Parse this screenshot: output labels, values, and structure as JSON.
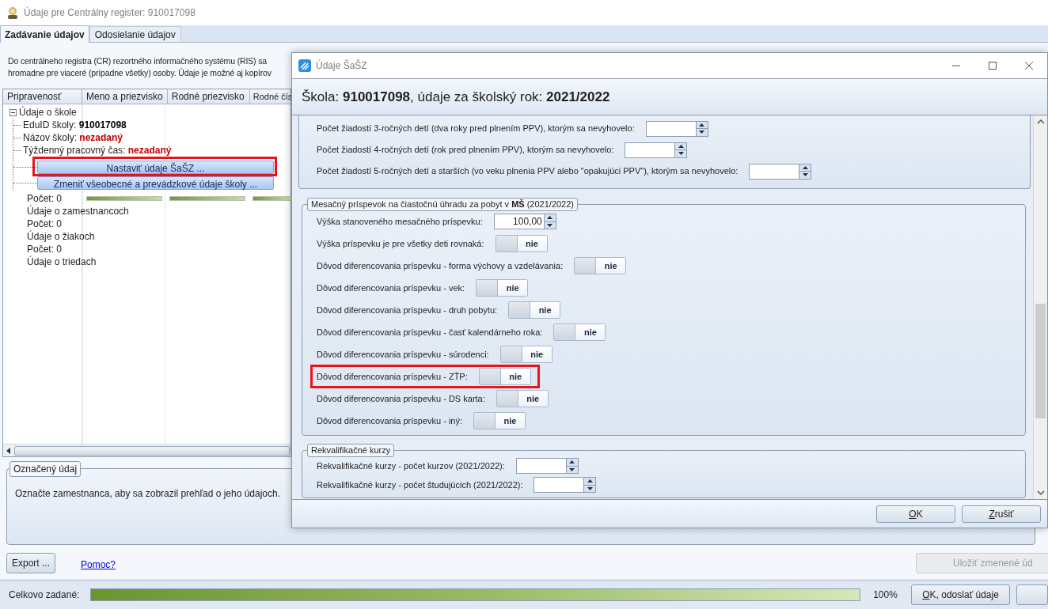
{
  "window": {
    "title": "Údaje pre Centrálny register: 910017098"
  },
  "tabs": [
    {
      "label": "Zadávanie údajov",
      "selected": true
    },
    {
      "label": "Odosielanie údajov",
      "selected": false
    }
  ],
  "description": [
    "Do centrálneho registra (CR) rezortného informačného systému (RIS) sa",
    "hromadne pre viaceré (prípadne všetky) osoby. Údaje je možné aj kopírov"
  ],
  "table": {
    "columns": [
      "Pripravenosť",
      "Meno a priezvisko",
      "Rodné priezvisko",
      "Rodné čís"
    ],
    "tree": {
      "label": "Údaje o škole",
      "expanded": true,
      "children": [
        {
          "kind": "field",
          "label": "EduID školy:",
          "value": "910017098",
          "missing": false
        },
        {
          "kind": "field",
          "label": "Názov školy:",
          "value": "nezadaný",
          "missing": true
        },
        {
          "kind": "field",
          "label": "Týždenný pracovný čas:",
          "value": "nezadaný",
          "missing": true
        },
        {
          "kind": "button",
          "label": "Nastaviť údaje ŠaŠZ ...",
          "highlighted": true
        },
        {
          "kind": "button",
          "label": "Zmeniť všeobecné a prevádzkové údaje školy ...",
          "highlighted": false
        }
      ]
    },
    "rows": [
      {
        "label": "Počet: 0",
        "progress": [
          {
            "level": 1
          },
          {
            "level": 1
          },
          {
            "level": 1
          }
        ]
      },
      {
        "label": "Údaje o zamestnancoch"
      },
      {
        "label": "Počet: 0"
      },
      {
        "label": "Údaje o žiakoch"
      },
      {
        "label": "Počet: 0"
      },
      {
        "label": "Údaje o triedach"
      }
    ]
  },
  "selected_item": {
    "title": "Označený údaj",
    "text": "Označte zamestnanca, aby sa zobrazil prehľad o jeho údajoch."
  },
  "actions": [
    {
      "kind": "button",
      "label": "Export ...",
      "disabled": false
    },
    {
      "kind": "link",
      "label": "Pomoc?"
    },
    {
      "kind": "button",
      "label": "Uložiť zmenené úd",
      "disabled": true
    }
  ],
  "status_bar": {
    "label": "Celkovo zadané:",
    "level": 1,
    "reading": "100%",
    "buttons": [
      "OK, odoslať údaje"
    ]
  },
  "dialog": {
    "title": "Údaje ŠaŠZ",
    "heading": "Škola: **910017098**, údaje za školský rok: **2021/2022**",
    "groups": [
      {
        "rows": [
          {
            "kind": "spin",
            "label": "Počet žiadostí 3-ročných detí (dva roky pred plnením PPV), ktorým sa nevyhovelo:"
          },
          {
            "kind": "spin",
            "label": "Počet žiadostí 4-ročných detí (rok pred plnením PPV), ktorým sa nevyhovelo:"
          },
          {
            "kind": "spin",
            "label": "Počet žiadostí 5-ročných detí a starších (vo veku plnenia PPV alebo \"opakujúci PPV\"), ktorým sa nevyhovelo:"
          }
        ]
      },
      {
        "legend": "Mesačný príspevok na čiastočnú úhradu za pobyt v **MŠ** (2021/2022)",
        "rows": [
          {
            "kind": "spin",
            "label": "Výška stanoveného mesačného príspevku:",
            "value": "100,00"
          },
          {
            "kind": "toggle",
            "label": "Výška príspevku je pre všetky deti rovnaká:",
            "on": false,
            "text": "nie",
            "highlighted": false
          },
          {
            "kind": "toggle",
            "label": "Dôvod diferencovania príspevku - forma výchovy a vzdelávania:",
            "on": false,
            "text": "nie",
            "highlighted": false
          },
          {
            "kind": "toggle",
            "label": "Dôvod diferencovania príspevku - vek:",
            "on": false,
            "text": "nie",
            "highlighted": false
          },
          {
            "kind": "toggle",
            "label": "Dôvod diferencovania príspevku - druh pobytu:",
            "on": false,
            "text": "nie",
            "highlighted": false
          },
          {
            "kind": "toggle",
            "label": "Dôvod diferencovania príspevku - časť kalendárneho roka:",
            "on": false,
            "text": "nie",
            "highlighted": false
          },
          {
            "kind": "toggle",
            "label": "Dôvod diferencovania príspevku - súrodenci:",
            "on": false,
            "text": "nie",
            "highlighted": false
          },
          {
            "kind": "toggle",
            "label": "Dôvod diferencovania príspevku - ZŤP:",
            "on": false,
            "text": "nie",
            "highlighted": true
          },
          {
            "kind": "toggle",
            "label": "Dôvod diferencovania príspevku - DS karta:",
            "on": false,
            "text": "nie",
            "highlighted": false
          },
          {
            "kind": "toggle",
            "label": "Dôvod diferencovania príspevku - iný:",
            "on": false,
            "text": "nie",
            "highlighted": false
          }
        ]
      },
      {
        "legend": "Rekvalifikačné kurzy",
        "rows": [
          {
            "kind": "spin",
            "label": "Rekvalifikačné kurzy - počet kurzov (2021/2022):"
          },
          {
            "kind": "spin",
            "label": "Rekvalifikačné kurzy - počet študujúcich (2021/2022):"
          }
        ]
      }
    ],
    "buttons": [
      "OK",
      "Zrušiť"
    ]
  }
}
